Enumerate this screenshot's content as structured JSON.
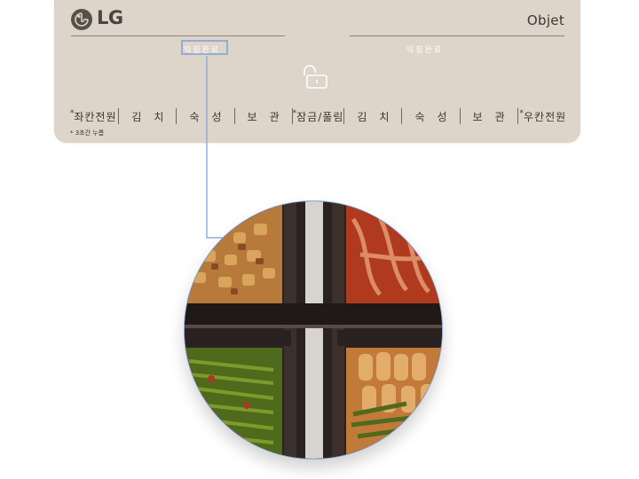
{
  "brand": {
    "name": "LG",
    "series": "Objet"
  },
  "status": {
    "left_label": "익힘완료",
    "right_label": "익힘완료"
  },
  "controls": {
    "left_power": "좌칸전원",
    "left_kimchi": "김치",
    "left_ripen": "숙성",
    "left_store": "보관",
    "lock_release": "잠금/풀림",
    "right_kimchi": "김치",
    "right_ripen": "숙성",
    "right_store": "보관",
    "right_power": "우칸전원",
    "star": "*"
  },
  "footnote": "* 3초간 누름",
  "icons": {
    "lock": "lock-open-icon",
    "logo": "lg-logo-icon"
  },
  "colors": {
    "panel": "#ddd4ca",
    "highlight": "#93add8",
    "status_text": "#ffffff"
  }
}
